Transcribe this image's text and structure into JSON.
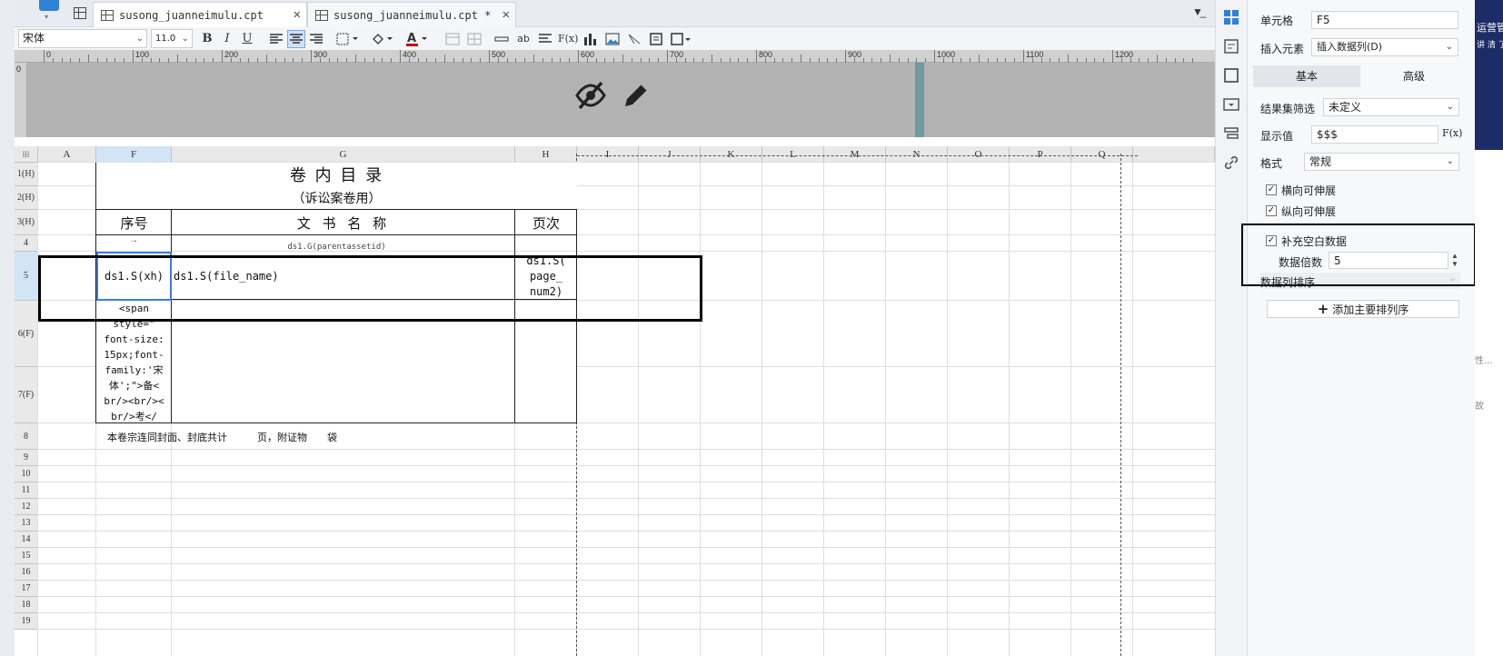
{
  "tabs": [
    {
      "label": "susong_juanneimulu.cpt",
      "active": true
    },
    {
      "label": "susong_juanneimulu.cpt *",
      "active": false
    }
  ],
  "toolbar": {
    "font_family": "宋体",
    "font_size": "11.0",
    "bold": "B",
    "italic": "I",
    "underline": "U",
    "text_abbr": "ab",
    "fx": "F(x)"
  },
  "ruler": {
    "labels": [
      "0",
      "100",
      "200",
      "300",
      "400",
      "500",
      "600",
      "700",
      "800",
      "900",
      "1000",
      "1100",
      "1200"
    ],
    "vertical_label": "0"
  },
  "sheet": {
    "columns": [
      "A",
      "F",
      "G",
      "H",
      "I",
      "J",
      "K",
      "L",
      "M",
      "N",
      "O",
      "P",
      "Q"
    ],
    "rows": [
      "1(H)",
      "2(H)",
      "3(H)",
      "4",
      "5",
      "6(F)",
      "7(F)",
      "8",
      "9",
      "10",
      "11",
      "12",
      "13",
      "14",
      "15",
      "16",
      "17",
      "18",
      "19"
    ],
    "title": "卷 内 目 录",
    "subtitle": "（诉讼案卷用）",
    "header_seq": "序号",
    "header_name": "文 书 名 称",
    "header_page": "页次",
    "row4_expr": "ds1.G(parentassetid)",
    "f5_expr": "ds1.S(xh)",
    "g5_expr": "ds1.S(file_name)",
    "h5_expr": "ds1.S(page_num2)",
    "h5_lines": [
      "ds1.S(",
      "page_",
      "num2)"
    ],
    "f6_lines": [
      "<span",
      "style=\"",
      "font-size:",
      "15px;font-",
      "family:'宋",
      "体';\">备<",
      "br/><br/><",
      "br/>考</"
    ],
    "row8_text": "本卷宗连同封面、封底共计　　　页，附证物　　袋"
  },
  "panel": {
    "cell_label": "单元格",
    "cell_value": "F5",
    "insert_label": "插入元素",
    "insert_value": "插入数据列(D)",
    "tab_basic": "基本",
    "tab_advanced": "高级",
    "filter_label": "结果集筛选",
    "filter_value": "未定义",
    "display_label": "显示值",
    "display_value": "$$$",
    "display_fx": "F(x)",
    "format_label": "格式",
    "format_value": "常规",
    "h_expand": "横向可伸展",
    "v_expand": "纵向可伸展",
    "fill_blank": "补充空白数据",
    "data_multiple_label": "数据倍数",
    "data_multiple_value": "5",
    "sort_label": "数据列排序",
    "add_sort": "添加主要排列序"
  },
  "side_fragments": [
    "运营管",
    "讲 清 了",
    "性...",
    "故"
  ]
}
